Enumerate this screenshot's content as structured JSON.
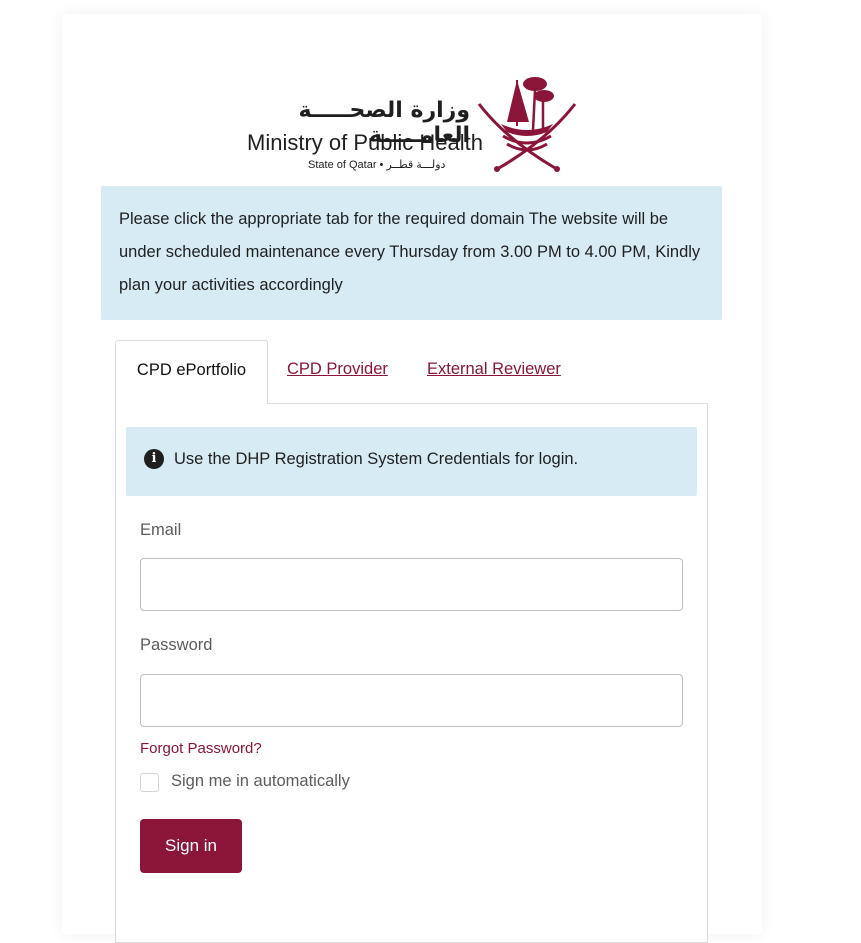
{
  "logo": {
    "arabic": "وزارة الصحـــــة العامـــــة",
    "english": "Ministry of Public Health",
    "state": "State of Qatar • دولـــة قطــر"
  },
  "notice": {
    "text": "Please click the appropriate tab for the required domain The website will be under scheduled maintenance every Thursday from 3.00 PM to 4.00 PM, Kindly plan your activities accordingly"
  },
  "tabs": [
    {
      "label": "CPD ePortfolio",
      "active": true
    },
    {
      "label": "CPD Provider",
      "active": false
    },
    {
      "label": "External Reviewer",
      "active": false
    }
  ],
  "info": {
    "icon": "info-circle-icon",
    "text": "Use the DHP Registration System Credentials for login."
  },
  "form": {
    "email_label": "Email",
    "email_value": "",
    "password_label": "Password",
    "password_value": "",
    "forgot_label": "Forgot Password?",
    "remember_label": "Sign me in automatically",
    "remember_checked": false,
    "signin_label": "Sign in"
  },
  "colors": {
    "brand": "#8a1538",
    "info_bg": "#d6ebf3"
  }
}
